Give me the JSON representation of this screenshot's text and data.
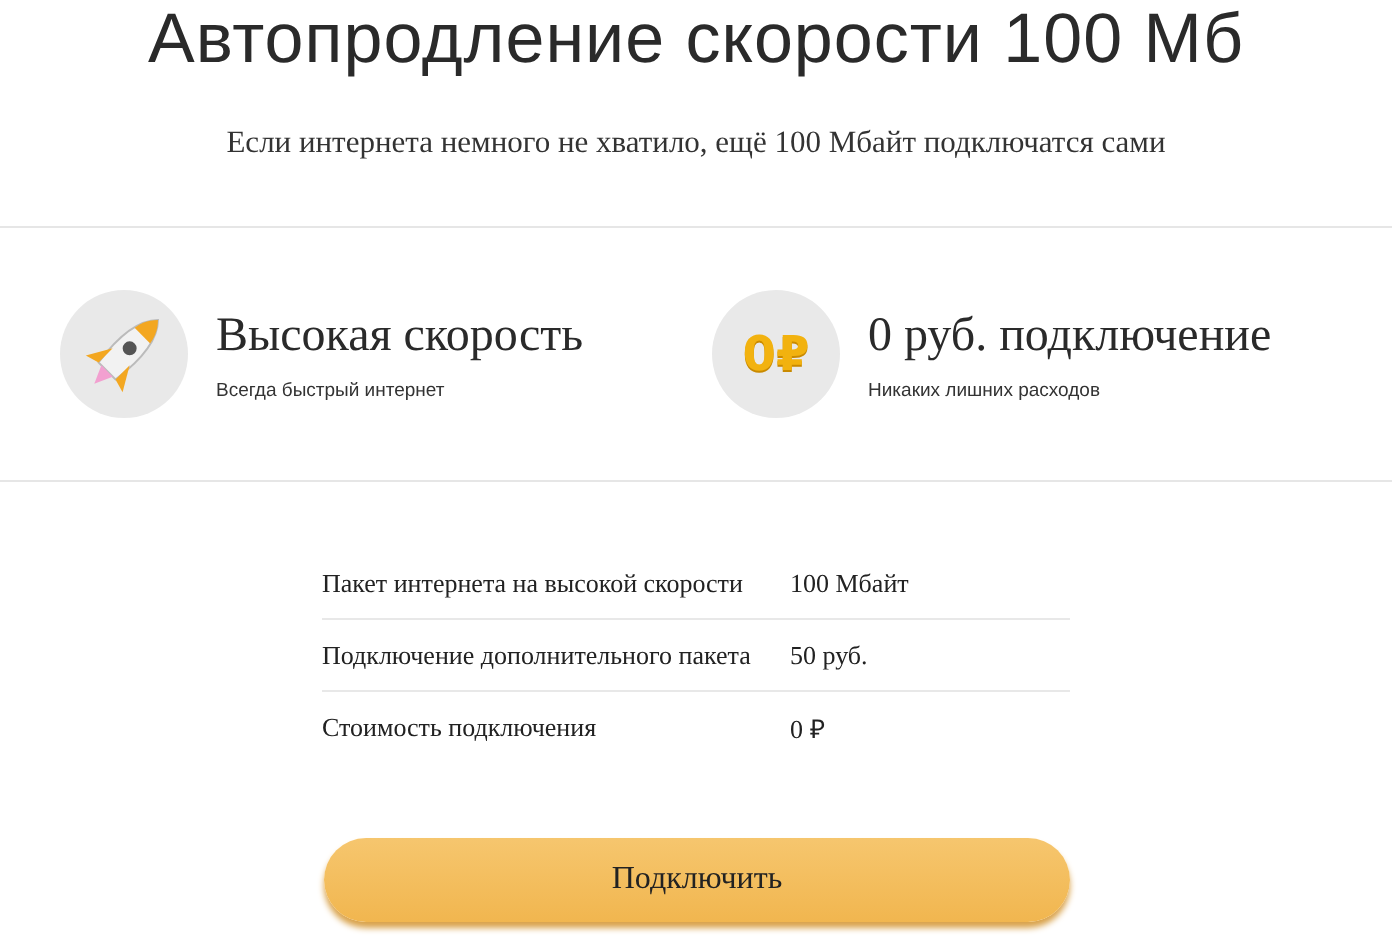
{
  "title": "Автопродление скорости 100 Мб",
  "subtitle": "Если интернета немного не хватило, ещё 100 Мбайт подключатся сами",
  "features": [
    {
      "kind": "rocket",
      "title": "Высокая скорость",
      "caption": "Всегда быстрый интернет"
    },
    {
      "kind": "coin",
      "badge": "0₽",
      "title": "0 руб. подключение",
      "caption": "Никаких лишних расходов"
    }
  ],
  "table": {
    "rows": [
      {
        "label": "Пакет интернета на высокой скорости",
        "value": "100 Мбайт"
      },
      {
        "label": "Подключение дополнительного пакета",
        "value": "50 руб."
      },
      {
        "label": "Стоимость подключения",
        "value": "0 ₽"
      }
    ]
  },
  "button": "Подключить"
}
